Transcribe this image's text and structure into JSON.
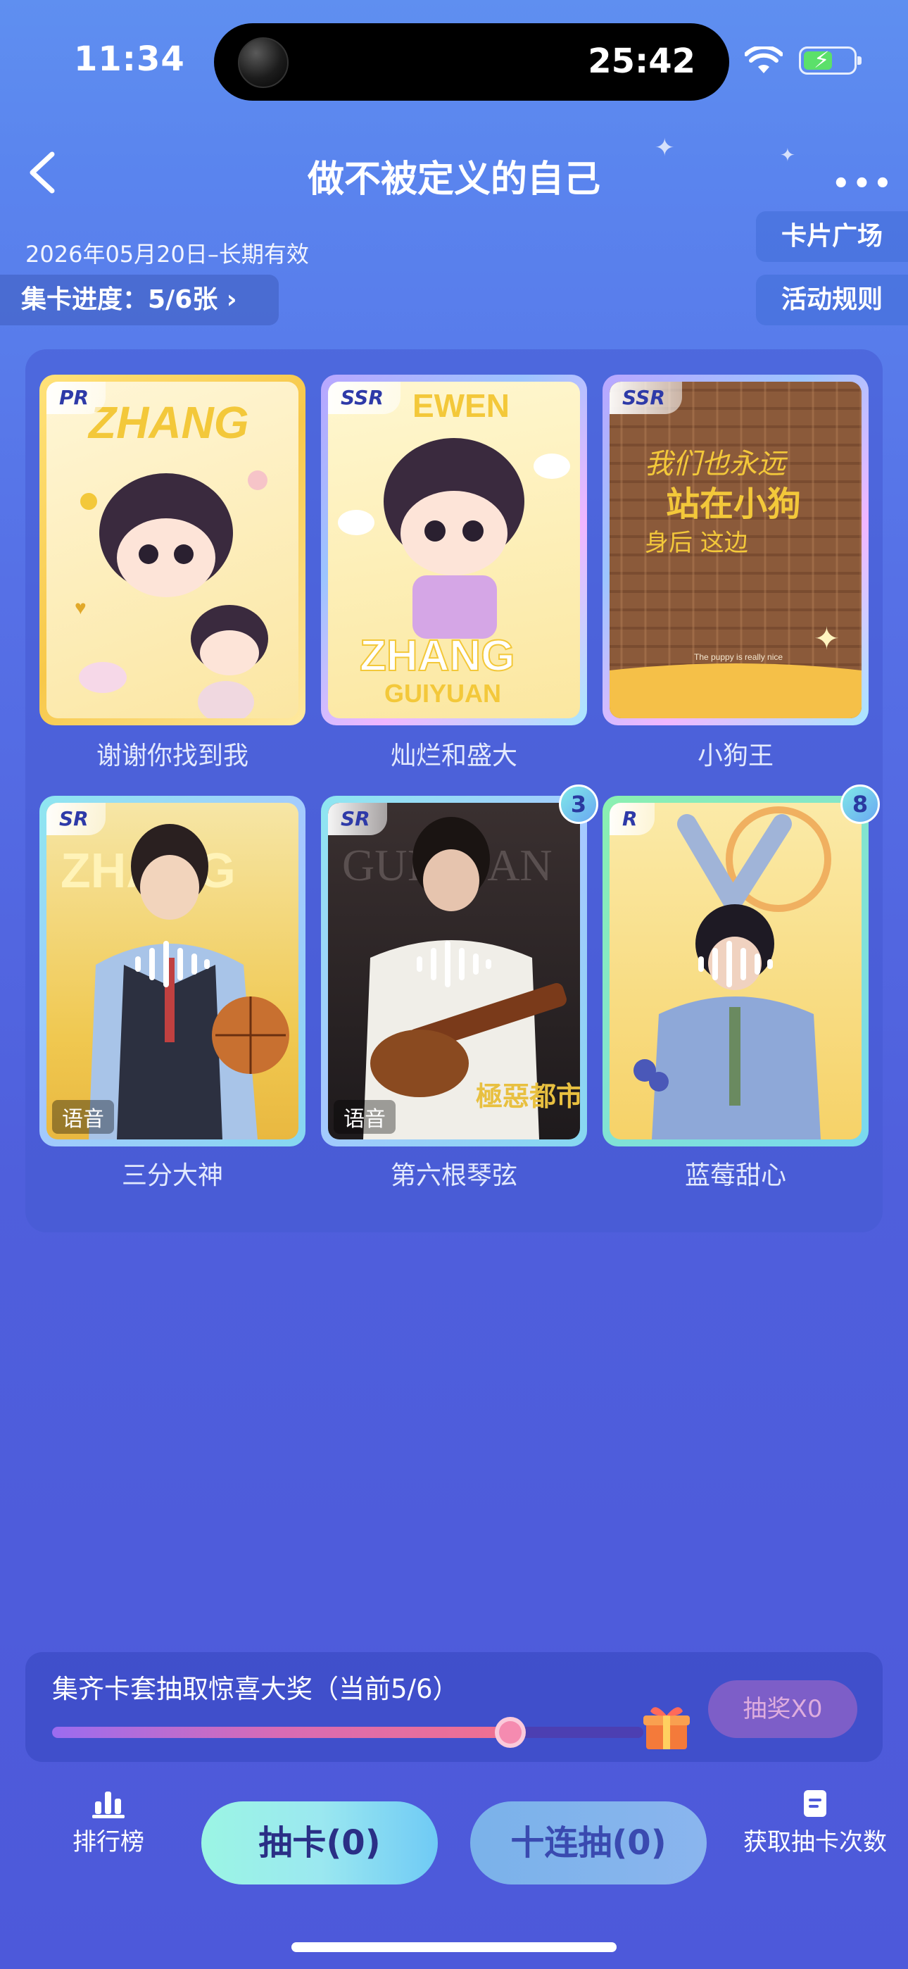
{
  "status_bar": {
    "time": "11:34",
    "timer": "25:42"
  },
  "header": {
    "title": "做不被定义的自己",
    "more": "•••"
  },
  "meta": {
    "validity": "2026年05月20日–长期有效",
    "progress": "集卡进度：5/6张 ›"
  },
  "side_buttons": {
    "card_plaza": "卡片广场",
    "rules": "活动规则"
  },
  "cards": [
    {
      "rarity": "PR",
      "label": "谢谢你找到我",
      "count": null,
      "voice": null
    },
    {
      "rarity": "SSR",
      "label": "灿烂和盛大",
      "count": null,
      "voice": null
    },
    {
      "rarity": "SSR",
      "label": "小狗王",
      "count": null,
      "voice": null
    },
    {
      "rarity": "SR",
      "label": "三分大神",
      "count": null,
      "voice": "语音"
    },
    {
      "rarity": "SR",
      "label": "第六根琴弦",
      "count": "3",
      "voice": "语音"
    },
    {
      "rarity": "R",
      "label": "蓝莓甜心",
      "count": "8",
      "voice": null
    }
  ],
  "card_art": {
    "c1": "ZHANG",
    "c2_top": "EWEN",
    "c2_main": "ZHANG",
    "c2_sub": "GUIYUAN",
    "c3_line1": "我们也永远",
    "c3_line2": "站在小狗",
    "c3_line3": "身后 这边",
    "c3_caption": "The puppy is really nice",
    "c4": "ZHANG",
    "c5": "GUIYUAN",
    "c5_stamp": "極惡都市"
  },
  "lottery": {
    "title": "集齐卡套抽取惊喜大奖（当前5/6）",
    "progress": 0.833,
    "button": "抽奖X0"
  },
  "bottom": {
    "ranking": "排行榜",
    "draw_one": "抽卡(0)",
    "draw_ten": "十连抽(0)",
    "get_chances": "获取抽卡次数"
  },
  "colors": {
    "accent": "#5a84ee",
    "progress_fill": "#d86bb4",
    "draw_button": "#9be8f0"
  }
}
